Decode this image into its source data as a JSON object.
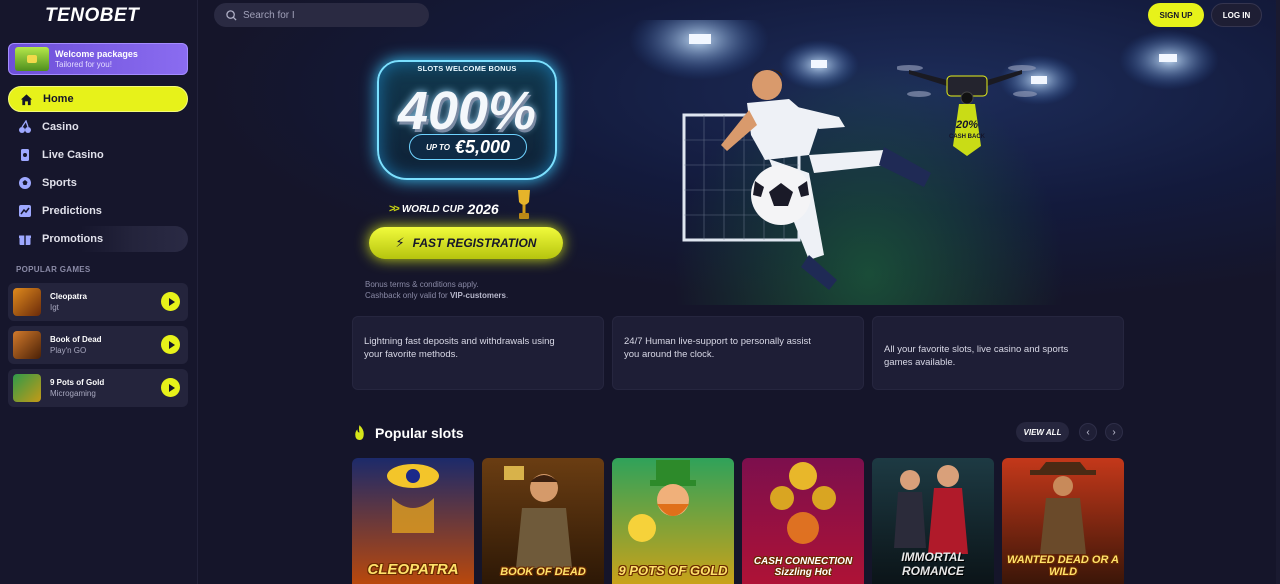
{
  "brand": {
    "logo": "TENOBET"
  },
  "sidebar": {
    "promo": {
      "title": "Welcome packages",
      "subtitle": "Tailored for you!"
    },
    "nav": [
      {
        "label": "Home",
        "icon": "home-icon"
      },
      {
        "label": "Casino",
        "icon": "cherries-icon"
      },
      {
        "label": "Live Casino",
        "icon": "live-casino-icon"
      },
      {
        "label": "Sports",
        "icon": "soccer-ball-icon"
      },
      {
        "label": "Predictions",
        "icon": "chart-icon"
      },
      {
        "label": "Promotions",
        "icon": "gift-icon"
      }
    ],
    "popular_label": "POPULAR GAMES",
    "games": [
      {
        "name": "Cleopatra",
        "provider": "Igt"
      },
      {
        "name": "Book of Dead",
        "provider": "Play'n GO"
      },
      {
        "name": "9 Pots of Gold",
        "provider": "Microgaming"
      }
    ]
  },
  "topbar": {
    "search_placeholder": "Search for I",
    "signup": "SIGN UP",
    "login": "LOG IN"
  },
  "hero": {
    "badge_top": "SLOTS WELCOME BONUS",
    "percent": "400%",
    "up_to": "UP TO",
    "amount": "€5,000",
    "world_cup": "WORLD CUP",
    "year": "2026",
    "cta": "FAST REGISTRATION",
    "terms_line1": "Bonus terms & conditions apply.",
    "terms_line2_prefix": "Cashback only valid for ",
    "terms_line2_bold": "VIP-customers",
    "terms_line2_suffix": ".",
    "cashback_pct": "20%",
    "cashback_label": "CASH BACK"
  },
  "features": [
    "Lightning fast deposits and withdrawals using your favorite methods.",
    "24/7 Human live-support to personally assist you around the clock.",
    "All your favorite slots, live casino and sports games available."
  ],
  "slots": {
    "title": "Popular slots",
    "view_all": "VIEW ALL",
    "items": [
      {
        "title": "CLEOPATRA",
        "colors": [
          "#1c2a6a",
          "#b9480c"
        ]
      },
      {
        "title": "BOOK OF DEAD",
        "colors": [
          "#6a3d12",
          "#2d1806"
        ]
      },
      {
        "title": "9 POTS OF GOLD",
        "colors": [
          "#2fa25a",
          "#c9a21a"
        ]
      },
      {
        "title": "CASH CONNECTION Sizzling Hot",
        "colors": [
          "#7c0f4d",
          "#ae1236"
        ]
      },
      {
        "title": "IMMORTAL ROMANCE",
        "colors": [
          "#1d3a43",
          "#0b1418"
        ]
      },
      {
        "title": "WANTED DEAD OR A WILD",
        "colors": [
          "#c4381a",
          "#3b1608"
        ]
      }
    ]
  },
  "colors": {
    "accent": "#e7f21a",
    "bg": "#15152a",
    "card": "#1e1e36"
  }
}
